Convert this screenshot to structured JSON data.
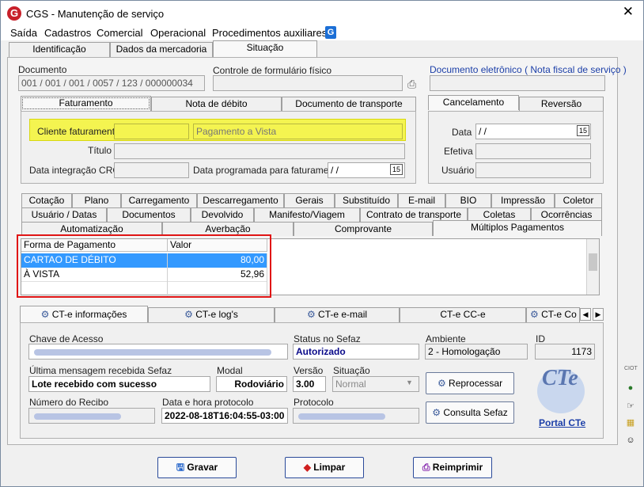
{
  "window": {
    "title": "CGS - Manutenção de serviço",
    "logo_letter": "G",
    "close_glyph": "✕"
  },
  "menu": [
    "Saída",
    "Cadastros",
    "Comercial",
    "Operacional",
    "Procedimentos auxiliares"
  ],
  "menu_logo_letter": "G",
  "top_tabs": [
    "Identificação",
    "Dados da mercadoria",
    "Situação"
  ],
  "documento": {
    "label": "Documento",
    "value": "001 / 001 / 001 / 0057 / 123 / 000000034"
  },
  "controle": {
    "label": "Controle de formulário físico",
    "value": ""
  },
  "doc_eletronico": {
    "label": "Documento eletrônico ( Nota fiscal de serviço )",
    "value": ""
  },
  "fat_tabs": [
    "Faturamento",
    "Nota de débito",
    "Documento de transporte"
  ],
  "canc_tabs": [
    "Cancelamento",
    "Reversão"
  ],
  "faturamento": {
    "cliente_label": "Cliente faturamento",
    "cliente_value": "",
    "pagamento_value": "Pagamento a Vista",
    "titulo_label": "Título",
    "crc_label": "Data integração CRC",
    "programada_label": "Data programada para faturamento",
    "programada_value": " /  /",
    "cal_glyph": "15"
  },
  "cancelamento": {
    "data_label": "Data",
    "data_value": " /  /",
    "efetiva_label": "Efetiva",
    "usuario_label": "Usuário",
    "cal_glyph": "15"
  },
  "tabs_row1": [
    "Cotação",
    "Plano",
    "Carregamento",
    "Descarregamento",
    "Gerais",
    "Substituído",
    "E-mail",
    "BIO",
    "Impressão",
    "Coletor"
  ],
  "tabs_row2": [
    "Usuário / Datas",
    "Documentos",
    "Devolvido",
    "Manifesto/Viagem",
    "Contrato de transporte",
    "Coletas",
    "Ocorrências"
  ],
  "tabs_row3": [
    "Automatização",
    "Averbação",
    "Comprovante",
    "Múltiplos Pagamentos"
  ],
  "pagamentos": {
    "columns": [
      "Forma de Pagamento",
      "Valor"
    ],
    "rows": [
      {
        "forma": "CARTAO DE DÉBITO",
        "valor": "80,00"
      },
      {
        "forma": "À VISTA",
        "valor": "52,96"
      }
    ]
  },
  "cte_tabs": [
    "CT-e informações",
    "CT-e log's",
    "CT-e e-mail",
    "CT-e CC-e",
    "CT-e Co"
  ],
  "cte": {
    "chave_label": "Chave de Acesso",
    "status_label": "Status no Sefaz",
    "status_value": "Autorizado",
    "ambiente_label": "Ambiente",
    "ambiente_value": "2 - Homologação",
    "id_label": "ID",
    "id_value": "1173",
    "ultima_label": "Última mensagem recebida Sefaz",
    "ultima_value": "Lote recebido com sucesso",
    "modal_label": "Modal",
    "modal_value": "Rodoviário",
    "versao_label": "Versão",
    "versao_value": "3.00",
    "situacao_label": "Situação",
    "situacao_value": "Normal",
    "recibo_label": "Número do Recibo",
    "datahora_label": "Data e hora protocolo",
    "datahora_value": "2022-08-18T16:04:55-03:00",
    "protocolo_label": "Protocolo",
    "reprocessar_label": "Reprocessar",
    "consulta_label": "Consulta Sefaz",
    "portal_label": "Portal CTe",
    "logo_text": "CTe"
  },
  "buttons": {
    "gravar": "Gravar",
    "limpar": "Limpar",
    "reimprimir": "Reimprimir"
  },
  "side_label": "CIOT",
  "colors": {
    "selection": "#3399ff",
    "highlight_yellow": "#f4f450",
    "red_box": "#e01515",
    "link": "#1c3fa8"
  }
}
